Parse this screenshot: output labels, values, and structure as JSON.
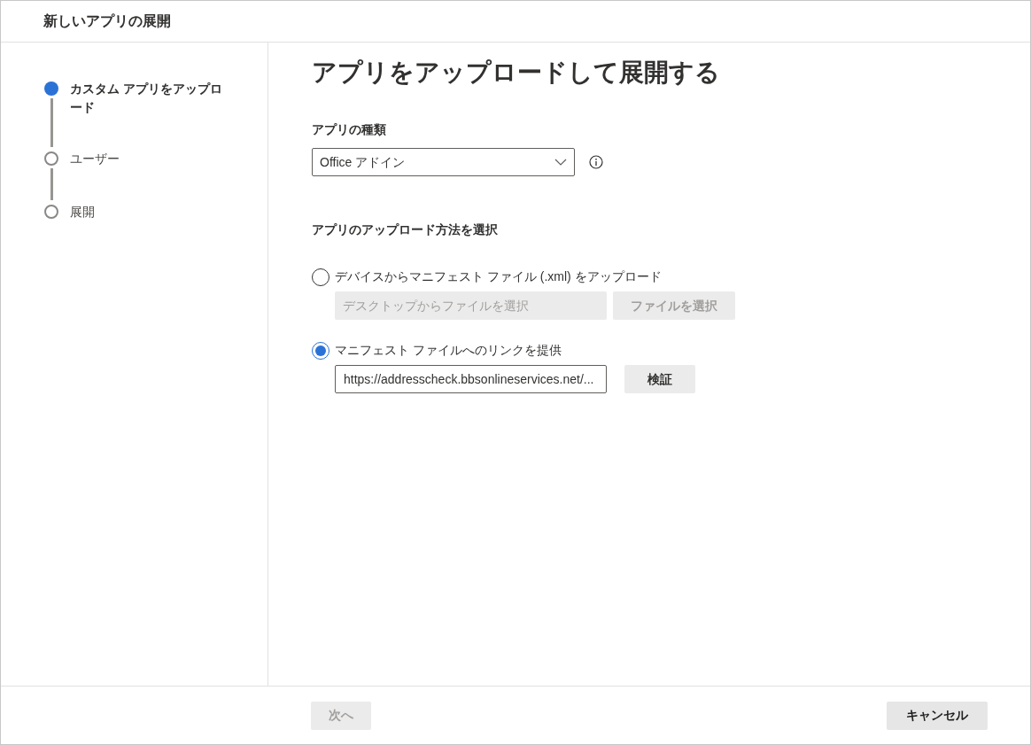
{
  "dialog": {
    "title": "新しいアプリの展開"
  },
  "steps": [
    {
      "label": "カスタム アプリをアップロード",
      "selected": true
    },
    {
      "label": "ユーザー",
      "selected": false
    },
    {
      "label": "展開",
      "selected": false
    }
  ],
  "main": {
    "heading": "アプリをアップロードして展開する",
    "app_type": {
      "label": "アプリの種類",
      "value": "Office アドイン"
    },
    "method_label": "アプリのアップロード方法を選択",
    "options": [
      {
        "label": "デバイスからマニフェスト ファイル (.xml) をアップロード",
        "selected": false,
        "disabled": true,
        "field": {
          "placeholder": "デスクトップからファイルを選択"
        },
        "button": "ファイルを選択"
      },
      {
        "label": "マニフェスト ファイルへのリンクを提供",
        "selected": true,
        "disabled": false,
        "field": {
          "value": "https://addresscheck.bbsonlineservices.net/..."
        },
        "button": "検証"
      }
    ]
  },
  "footer": {
    "next": {
      "label": "次へ",
      "disabled": true
    },
    "cancel": {
      "label": "キャンセル",
      "disabled": false
    }
  }
}
